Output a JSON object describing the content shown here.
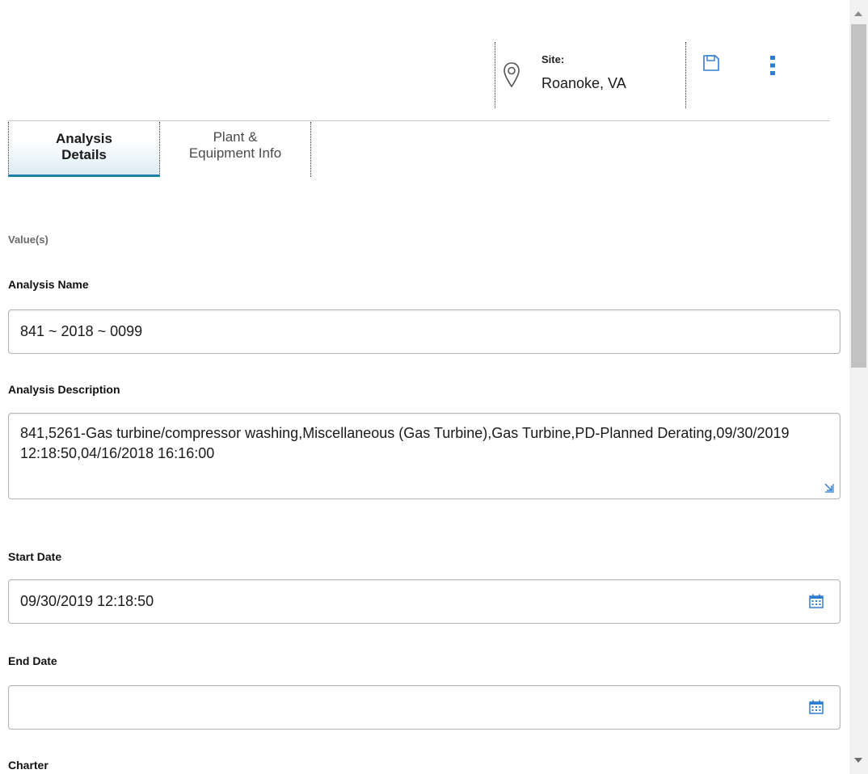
{
  "header": {
    "site_label": "Site:",
    "site_value": "Roanoke, VA",
    "icons": [
      "location-pin-icon",
      "save-icon",
      "more-vertical-icon"
    ]
  },
  "tabs": [
    {
      "line1": "Analysis",
      "line2": "Details",
      "active": true
    },
    {
      "line1": "Plant &",
      "line2": "Equipment Info",
      "active": false
    }
  ],
  "form": {
    "section_label": "Value(s)",
    "analysis_name": {
      "label": "Analysis Name",
      "value": "841 ~ 2018 ~ 0099"
    },
    "analysis_description": {
      "label": "Analysis Description",
      "value": "841,5261-Gas turbine/compressor washing,Miscellaneous (Gas Turbine),Gas Turbine,PD-Planned Derating,09/30/2019 12:18:50,04/16/2018 16:16:00"
    },
    "start_date": {
      "label": "Start Date",
      "value": "09/30/2019 12:18:50"
    },
    "end_date": {
      "label": "End Date",
      "value": ""
    },
    "charter": {
      "label": "Charter"
    }
  },
  "colors": {
    "accent": "#1e7fa8",
    "icon_blue": "#2f7dd1",
    "border": "#b5b5b5"
  }
}
